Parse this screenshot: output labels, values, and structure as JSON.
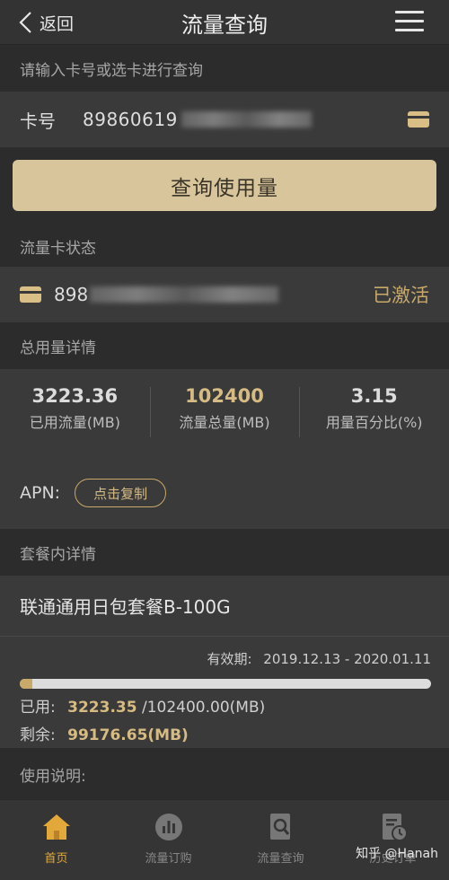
{
  "header": {
    "back_label": "返回",
    "title": "流量查询"
  },
  "query": {
    "prompt": "请输入卡号或选卡进行查询",
    "card_label": "卡号",
    "card_number_visible": "89860619",
    "button_label": "查询使用量"
  },
  "status": {
    "section_title": "流量卡状态",
    "card_number_visible": "898",
    "state": "已激活"
  },
  "usage": {
    "section_title": "总用量详情",
    "used_value": "3223.36",
    "used_label": "已用流量(MB)",
    "total_value": "102400",
    "total_label": "流量总量(MB)",
    "percent_value": "3.15",
    "percent_label": "用量百分比(%)",
    "apn_label": "APN:",
    "copy_label": "点击复制"
  },
  "plan": {
    "section_title": "套餐内详情",
    "name": "联通通用日包套餐B-100G",
    "validity_label": "有效期:",
    "validity_range": "2019.12.13 - 2020.01.11",
    "used_fraction": 0.0315,
    "used_label": "已用:",
    "used_value": "3223.35",
    "used_total": "/102400.00(MB)",
    "remaining_label": "剩余:",
    "remaining_value": "99176.65(MB)"
  },
  "instructions": {
    "title": "使用说明:"
  },
  "tabbar": {
    "items": [
      {
        "label": "首页",
        "icon": "home-icon",
        "active": true
      },
      {
        "label": "流量订购",
        "icon": "chart-icon",
        "active": false
      },
      {
        "label": "流量查询",
        "icon": "search-doc-icon",
        "active": false
      },
      {
        "label": "历史订单",
        "icon": "history-doc-icon",
        "active": false
      }
    ]
  },
  "watermark": "知乎 @Hanah",
  "colors": {
    "accent_gold": "#d6bb83",
    "button_bg": "#d8c59b",
    "active_tab": "#e2a93a"
  }
}
